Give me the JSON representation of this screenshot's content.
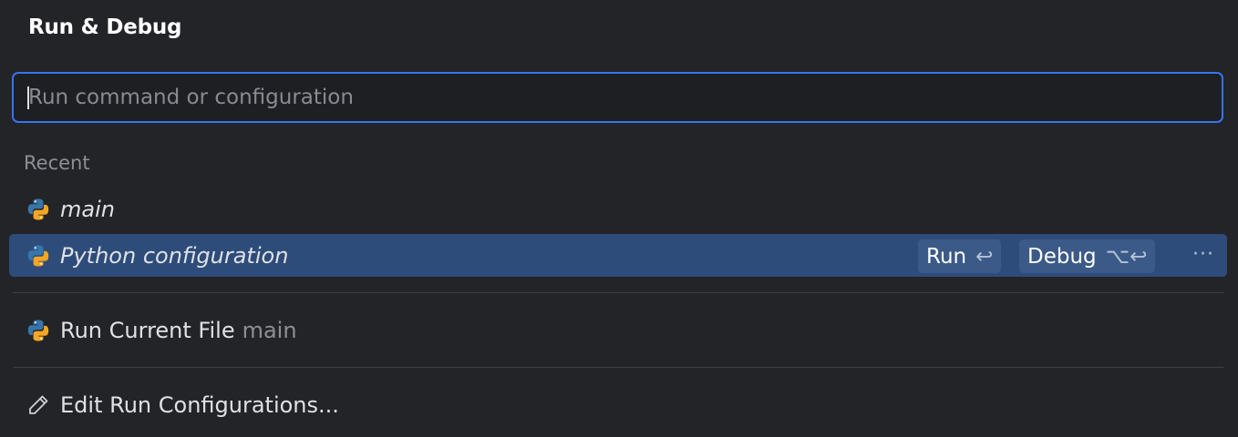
{
  "popup": {
    "title": "Run & Debug"
  },
  "search": {
    "placeholder": "Run command or configuration",
    "value": ""
  },
  "recent": {
    "section_label": "Recent",
    "items": [
      {
        "label": "main",
        "icon": "python-icon"
      },
      {
        "label": "Python configuration",
        "icon": "python-icon",
        "selected": true
      }
    ]
  },
  "selected_actions": {
    "run_label": "Run",
    "run_shortcut": "↩",
    "debug_label": "Debug",
    "debug_shortcut": "⌥↩",
    "more_label": "···"
  },
  "run_current_file": {
    "label": "Run Current File",
    "secondary": "main",
    "icon": "python-icon"
  },
  "edit_configurations": {
    "label": "Edit Run Configurations...",
    "icon": "pencil-icon"
  },
  "colors": {
    "background": "#232428",
    "selection": "#2e4c7a",
    "focus_border": "#3574f0",
    "python_blue": "#3776ab",
    "python_yellow": "#f5a623"
  }
}
